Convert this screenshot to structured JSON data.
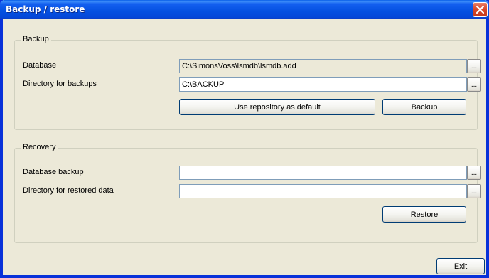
{
  "window": {
    "title": "Backup / restore"
  },
  "backup": {
    "group_label": "Backup",
    "database_label": "Database",
    "database_value": "C:\\SimonsVoss\\lsmdb\\lsmdb.add",
    "directory_label": "Directory for backups",
    "directory_value": "C:\\BACKUP",
    "browse_label": "...",
    "use_repository_label": "Use repository as default",
    "backup_button_label": "Backup"
  },
  "recovery": {
    "group_label": "Recovery",
    "database_backup_label": "Database backup",
    "database_backup_value": "",
    "restored_dir_label": "Directory for restored data",
    "restored_dir_value": "",
    "browse_label": "...",
    "restore_button_label": "Restore"
  },
  "footer": {
    "exit_label": "Exit"
  },
  "colors": {
    "titlebar": "#0054e3",
    "window_bg": "#ece9d8",
    "close_button": "#d8482a"
  }
}
